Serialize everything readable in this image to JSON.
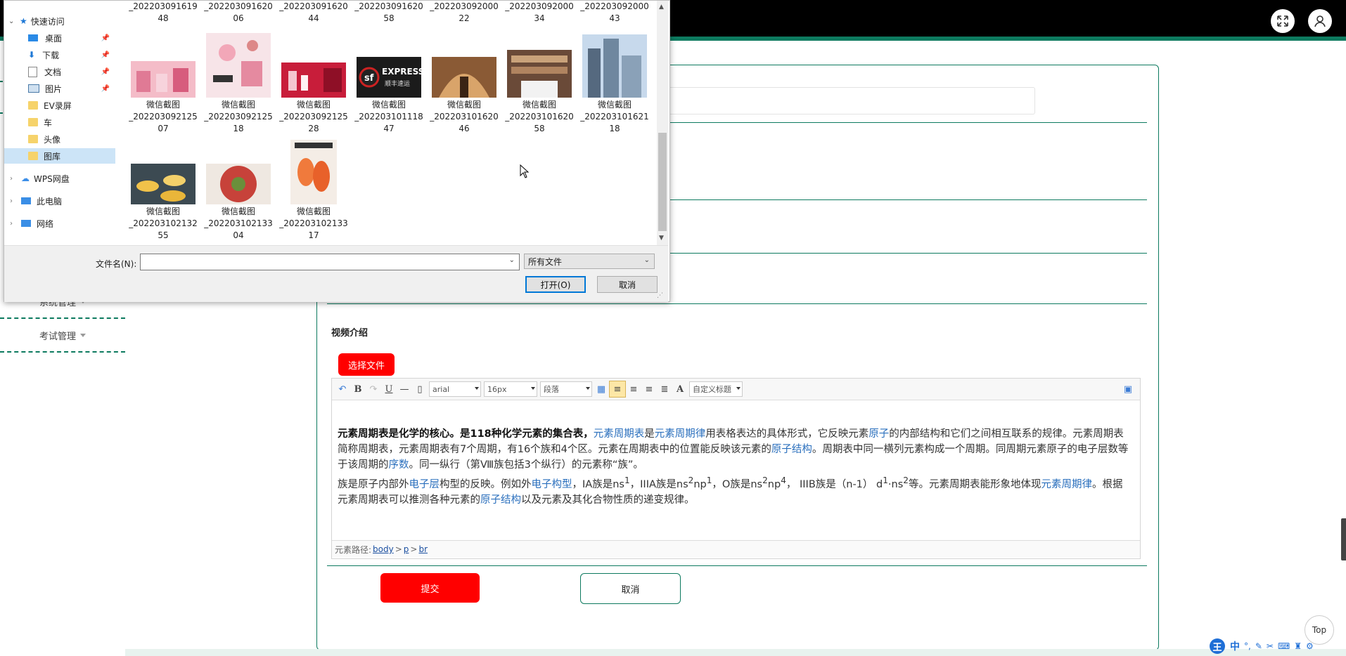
{
  "colors": {
    "brand": "#0d7a5f",
    "danger": "#ff0000",
    "link": "#2a6fbd"
  },
  "sidebar": {
    "items": [
      {
        "label": "系统管理"
      },
      {
        "label": "考试管理"
      }
    ]
  },
  "form": {
    "video_intro_label": "视频介绍",
    "choose_file_label": "选择文件",
    "submit_label": "提交",
    "cancel_label": "取消"
  },
  "editor": {
    "font_family": "arial",
    "font_size": "16px",
    "paragraph": "段落",
    "custom_title": "自定义标题",
    "path_label": "元素路径:",
    "path": [
      "body",
      "p",
      "br"
    ],
    "content": {
      "p1_bold": "元素周期表是化学的核心。是118种化学元素的集合表，",
      "p1_link1": "元素周期表",
      "p1_t1": "是",
      "p1_link2": "元素周期律",
      "p1_t2": "用表格表达的具体形式，它反映元素",
      "p1_link3": "原子",
      "p1_t3": "的内部结构和它们之间相互联系的规律。元素周期表简称周期表，元素周期表有7个周期，有16个族和4个区。元素在周期表中的位置能反映该元素的",
      "p1_link4": "原子结构",
      "p1_t4": "。周期表中同一横列元素构成一个周期。同周期元素原子的电子层数等于该周期的",
      "p1_link5": "序数",
      "p1_t5": "。同一纵行（第Ⅷ族包括3个纵行）的元素称“族”。",
      "p2_t1": "族是原子内部外",
      "p2_link1": "电子层",
      "p2_t2": "构型的反映。例如外",
      "p2_link2": "电子构型",
      "p2_t3": "，IA族是ns",
      "p2_s1": "1",
      "p2_t4": "，IIIA族是ns",
      "p2_s2": "2",
      "p2_t5": "np",
      "p2_s3": "1",
      "p2_t6": "，O族是ns",
      "p2_s4": "2",
      "p2_t7": "np",
      "p2_s5": "4",
      "p2_t8": "， IIIB族是（n-1） d",
      "p2_s6": "1",
      "p2_t9": "·ns",
      "p2_s7": "2",
      "p2_t10": "等。元素周期表能形象地体现",
      "p2_link3": "元素周期律",
      "p2_t11": "。根据元素周期表可以推测各种元素的",
      "p2_link4": "原子结构",
      "p2_t12": "以及元素及其化合物性质的递变规律。"
    }
  },
  "dialog": {
    "nav": [
      {
        "label": "快速访问",
        "icon": "star-icon"
      },
      {
        "label": "桌面",
        "icon": "desktop-icon"
      },
      {
        "label": "下载",
        "icon": "download-icon"
      },
      {
        "label": "文档",
        "icon": "document-icon"
      },
      {
        "label": "图片",
        "icon": "pictures-icon"
      },
      {
        "label": "EV录屏",
        "icon": "folder-icon"
      },
      {
        "label": "车",
        "icon": "folder-icon"
      },
      {
        "label": "头像",
        "icon": "folder-icon"
      },
      {
        "label": "图库",
        "icon": "folder-icon"
      },
      {
        "label": "WPS网盘",
        "icon": "cloud-icon"
      },
      {
        "label": "此电脑",
        "icon": "computer-icon"
      },
      {
        "label": "网络",
        "icon": "network-icon"
      }
    ],
    "top_row": [
      {
        "l1": "_202203091619",
        "l2": "48"
      },
      {
        "l1": "_202203091620",
        "l2": "06"
      },
      {
        "l1": "_202203091620",
        "l2": "44"
      },
      {
        "l1": "_202203091620",
        "l2": "58"
      },
      {
        "l1": "_202203092000",
        "l2": "22"
      },
      {
        "l1": "_202203092000",
        "l2": "34"
      },
      {
        "l1": "_202203092000",
        "l2": "43"
      }
    ],
    "row2": [
      {
        "l0": "微信截图",
        "l1": "_202203092125",
        "l2": "07"
      },
      {
        "l0": "微信截图",
        "l1": "_202203092125",
        "l2": "18"
      },
      {
        "l0": "微信截图",
        "l1": "_202203092125",
        "l2": "28"
      },
      {
        "l0": "微信截图",
        "l1": "_202203101118",
        "l2": "47"
      },
      {
        "l0": "微信截图",
        "l1": "_202203101620",
        "l2": "46"
      },
      {
        "l0": "微信截图",
        "l1": "_202203101620",
        "l2": "58"
      },
      {
        "l0": "微信截图",
        "l1": "_202203101621",
        "l2": "18"
      }
    ],
    "row3": [
      {
        "l0": "微信截图",
        "l1": "_202203102132",
        "l2": "55"
      },
      {
        "l0": "微信截图",
        "l1": "_202203102133",
        "l2": "04"
      },
      {
        "l0": "微信截图",
        "l1": "_202203102133",
        "l2": "17"
      }
    ],
    "thumb_text": {
      "express": "EXPRESS",
      "sf": "sf",
      "sf_cn": "顺丰速运"
    },
    "filename_label": "文件名(N):",
    "filename_value": "",
    "filetype": "所有文件",
    "open_label": "打开(O)",
    "cancel_label": "取消"
  },
  "misc": {
    "top_label": "Top",
    "ime": "中"
  }
}
